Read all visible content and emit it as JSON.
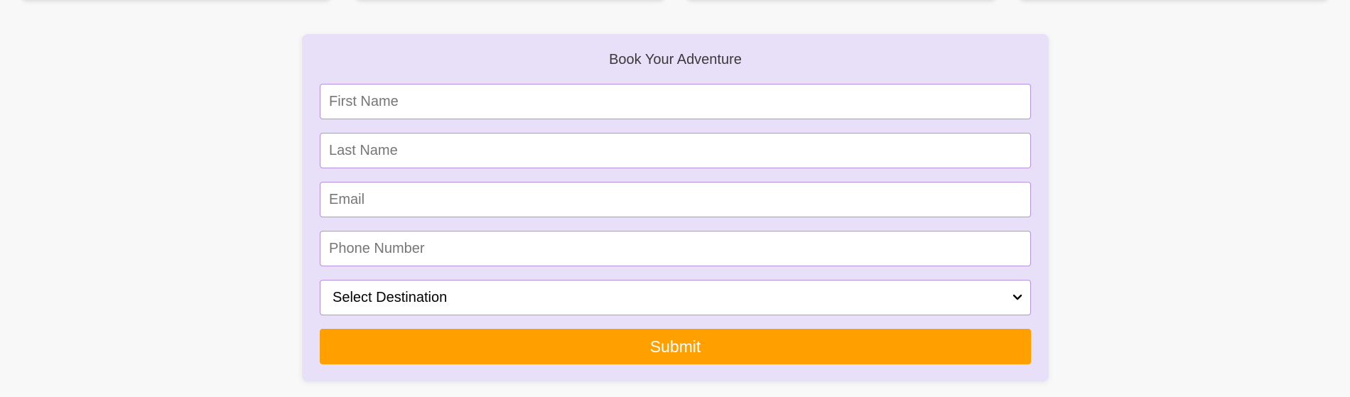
{
  "form": {
    "title": "Book Your Adventure",
    "first_name_placeholder": "First Name",
    "last_name_placeholder": "Last Name",
    "email_placeholder": "Email",
    "phone_placeholder": "Phone Number",
    "destination_selected": "Select Destination",
    "submit_label": "Submit"
  },
  "colors": {
    "page_background": "#f8f8f8",
    "card_background": "#e8dff8",
    "field_border": "#b790e0",
    "submit_background": "#ff9f00",
    "submit_text": "#ffffff"
  },
  "icons": {
    "select_chevron": "chevron-down-icon"
  }
}
